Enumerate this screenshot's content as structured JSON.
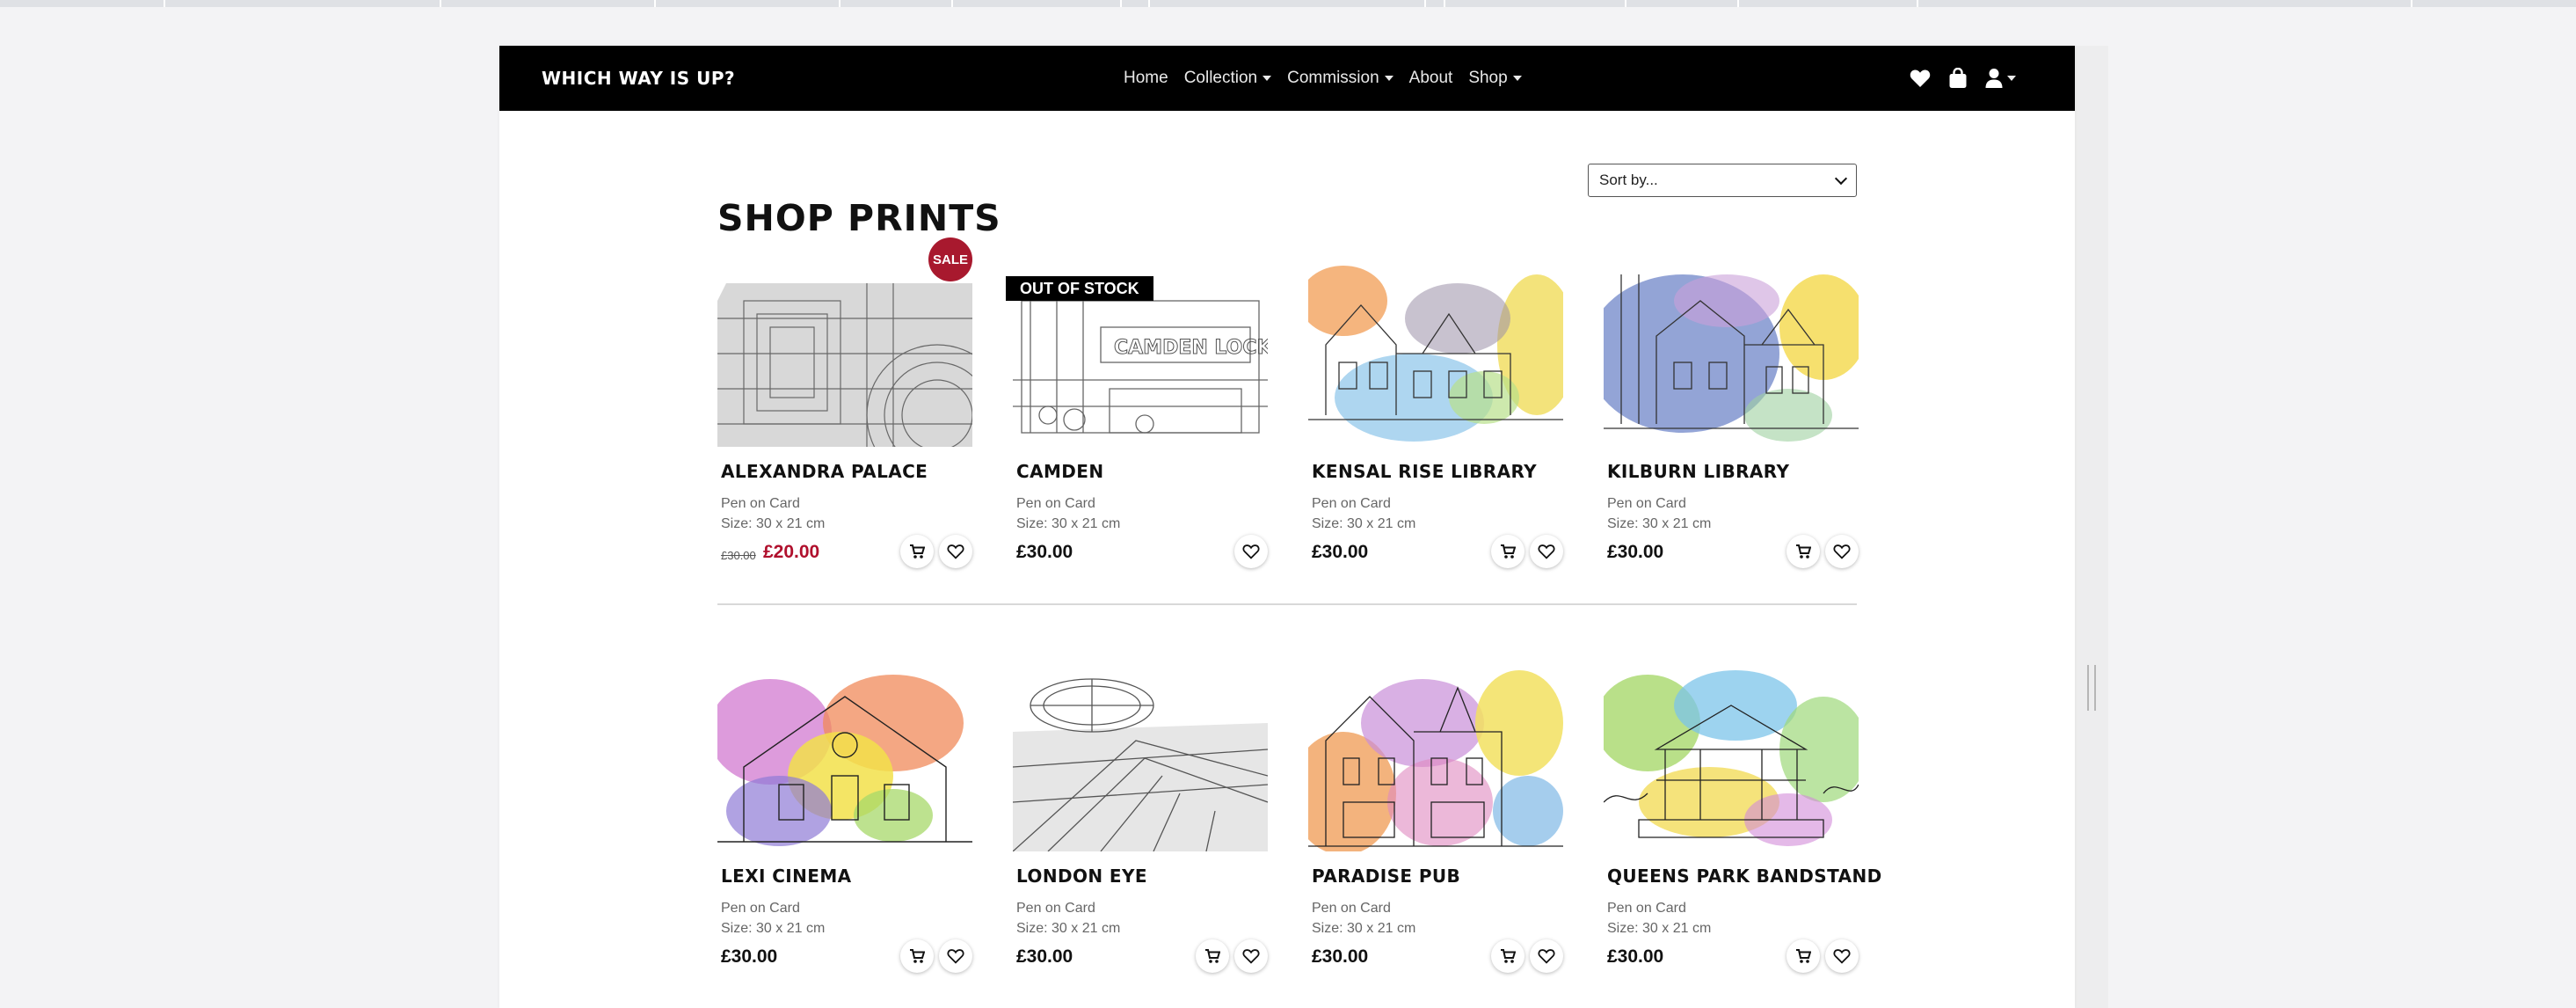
{
  "navbar": {
    "brand": "WHICH WAY IS UP?",
    "links": [
      {
        "label": "Home",
        "dropdown": false
      },
      {
        "label": "Collection",
        "dropdown": true
      },
      {
        "label": "Commission",
        "dropdown": true
      },
      {
        "label": "About",
        "dropdown": false
      },
      {
        "label": "Shop",
        "dropdown": true
      }
    ],
    "icons": [
      "heart-icon",
      "bag-icon",
      "user-icon"
    ]
  },
  "page": {
    "title": "SHOP PRINTS",
    "sort_label": "Sort by..."
  },
  "badges": {
    "sale": "SALE",
    "out_of_stock": "OUT OF STOCK"
  },
  "products": [
    {
      "name": "ALEXANDRA PALACE",
      "medium": "Pen on Card",
      "size": "Size: 30 x 21 cm",
      "old_price": "£30.00",
      "price": "£20.00"
    },
    {
      "name": "CAMDEN",
      "medium": "Pen on Card",
      "size": "Size: 30 x 21 cm",
      "price": "£30.00"
    },
    {
      "name": "KENSAL RISE LIBRARY",
      "medium": "Pen on Card",
      "size": "Size: 30 x 21 cm",
      "price": "£30.00"
    },
    {
      "name": "KILBURN LIBRARY",
      "medium": "Pen on Card",
      "size": "Size: 30 x 21 cm",
      "price": "£30.00"
    },
    {
      "name": "LEXI CINEMA",
      "medium": "Pen on Card",
      "size": "Size: 30 x 21 cm",
      "price": "£30.00"
    },
    {
      "name": "LONDON EYE",
      "medium": "Pen on Card",
      "size": "Size: 30 x 21 cm",
      "price": "£30.00"
    },
    {
      "name": "PARADISE PUB",
      "medium": "Pen on Card",
      "size": "Size: 30 x 21 cm",
      "price": "£30.00"
    },
    {
      "name": "QUEENS PARK BANDSTAND",
      "medium": "Pen on Card",
      "size": "Size: 30 x 21 cm",
      "price": "£30.00"
    }
  ],
  "colors": {
    "navbar_bg": "#000000",
    "sale_red": "#a8192e",
    "sale_price": "#b0102d"
  }
}
